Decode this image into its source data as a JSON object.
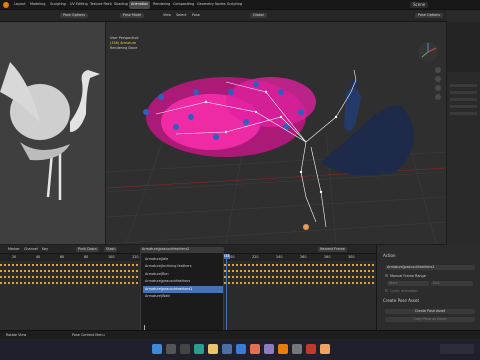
{
  "menubar": {
    "items": [
      "Layout",
      "Modeling",
      "Sculpting",
      "UV Editing",
      "Texture Paint",
      "Shading",
      "Animation",
      "Rendering",
      "Compositing",
      "Geometry Nodes",
      "Scripting"
    ],
    "active": "Animation",
    "scene": "Scene"
  },
  "viewport_header": {
    "mode": "Pose Mode",
    "menus": [
      "View",
      "Select",
      "Pose"
    ],
    "orientation": "Global",
    "left_options": "Pose Options",
    "right_options": "Pose Options"
  },
  "viewport_info": {
    "line1": "User Perspective",
    "line2": "(338) Armature",
    "line3": "Rendering Done"
  },
  "timeline": {
    "menus": [
      "Marker",
      "Channel",
      "Key"
    ],
    "push_down": "Push Down",
    "stash": "Stash",
    "action_name": "Armature|peacockfeathers2",
    "keying": "Nearest Frame",
    "ruler": [
      "20",
      "40",
      "60",
      "80",
      "100",
      "120",
      "140",
      "160",
      "180",
      "200",
      "220",
      "240",
      "260",
      "280",
      "300"
    ],
    "current_frame": "338"
  },
  "action_dropdown": {
    "items": [
      "Armature|Idle",
      "Armature|Inclining feathers",
      "Armature|Run",
      "Armature|peacockfeathers",
      "Armature|peacockfeathers2",
      "Armature|Walk"
    ],
    "selected_index": 4
  },
  "action_panel": {
    "title": "Action",
    "action": "Armature|peacockfeathers2",
    "manual_range": "Manual Frame Range",
    "start": "Start",
    "end": "End",
    "cyclic": "Cyclic Animation",
    "create_pose_asset": "Create Pose Asset",
    "create_button": "Create Pose Asset",
    "copy_button": "Copy Pose as Asset"
  },
  "playback": {
    "frame": "338",
    "start_label": "Start",
    "start_value": "1",
    "end_label": "End",
    "end_value": "338"
  },
  "status_bar": {
    "left": "Rotate View",
    "middle": "Pose Context Menu"
  },
  "colors": {
    "accent": "#4772b3",
    "keyframe": "#e6a32a",
    "feather": "#ff2fb0",
    "playhead": "#4772b3"
  }
}
